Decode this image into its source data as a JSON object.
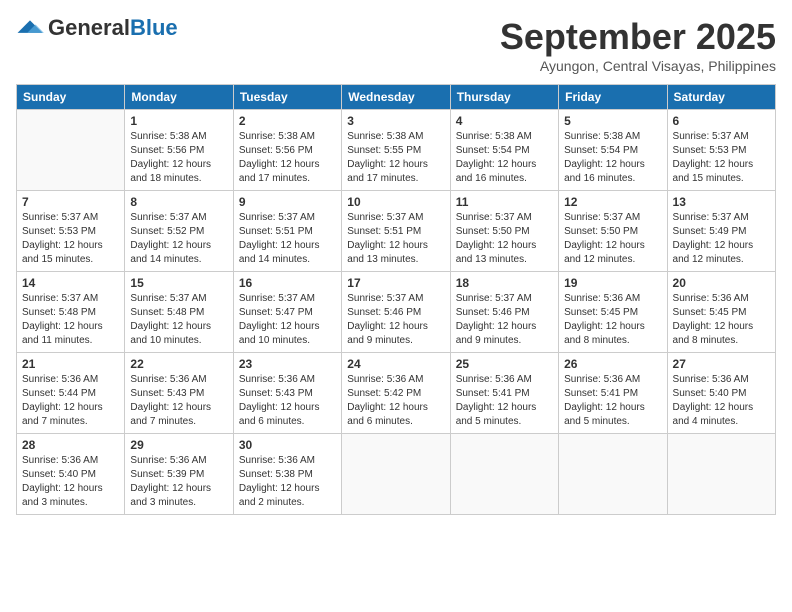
{
  "header": {
    "logo_general": "General",
    "logo_blue": "Blue",
    "month_title": "September 2025",
    "location": "Ayungon, Central Visayas, Philippines"
  },
  "weekdays": [
    "Sunday",
    "Monday",
    "Tuesday",
    "Wednesday",
    "Thursday",
    "Friday",
    "Saturday"
  ],
  "weeks": [
    [
      {
        "day": "",
        "info": ""
      },
      {
        "day": "1",
        "info": "Sunrise: 5:38 AM\nSunset: 5:56 PM\nDaylight: 12 hours\nand 18 minutes."
      },
      {
        "day": "2",
        "info": "Sunrise: 5:38 AM\nSunset: 5:56 PM\nDaylight: 12 hours\nand 17 minutes."
      },
      {
        "day": "3",
        "info": "Sunrise: 5:38 AM\nSunset: 5:55 PM\nDaylight: 12 hours\nand 17 minutes."
      },
      {
        "day": "4",
        "info": "Sunrise: 5:38 AM\nSunset: 5:54 PM\nDaylight: 12 hours\nand 16 minutes."
      },
      {
        "day": "5",
        "info": "Sunrise: 5:38 AM\nSunset: 5:54 PM\nDaylight: 12 hours\nand 16 minutes."
      },
      {
        "day": "6",
        "info": "Sunrise: 5:37 AM\nSunset: 5:53 PM\nDaylight: 12 hours\nand 15 minutes."
      }
    ],
    [
      {
        "day": "7",
        "info": "Sunrise: 5:37 AM\nSunset: 5:53 PM\nDaylight: 12 hours\nand 15 minutes."
      },
      {
        "day": "8",
        "info": "Sunrise: 5:37 AM\nSunset: 5:52 PM\nDaylight: 12 hours\nand 14 minutes."
      },
      {
        "day": "9",
        "info": "Sunrise: 5:37 AM\nSunset: 5:51 PM\nDaylight: 12 hours\nand 14 minutes."
      },
      {
        "day": "10",
        "info": "Sunrise: 5:37 AM\nSunset: 5:51 PM\nDaylight: 12 hours\nand 13 minutes."
      },
      {
        "day": "11",
        "info": "Sunrise: 5:37 AM\nSunset: 5:50 PM\nDaylight: 12 hours\nand 13 minutes."
      },
      {
        "day": "12",
        "info": "Sunrise: 5:37 AM\nSunset: 5:50 PM\nDaylight: 12 hours\nand 12 minutes."
      },
      {
        "day": "13",
        "info": "Sunrise: 5:37 AM\nSunset: 5:49 PM\nDaylight: 12 hours\nand 12 minutes."
      }
    ],
    [
      {
        "day": "14",
        "info": "Sunrise: 5:37 AM\nSunset: 5:48 PM\nDaylight: 12 hours\nand 11 minutes."
      },
      {
        "day": "15",
        "info": "Sunrise: 5:37 AM\nSunset: 5:48 PM\nDaylight: 12 hours\nand 10 minutes."
      },
      {
        "day": "16",
        "info": "Sunrise: 5:37 AM\nSunset: 5:47 PM\nDaylight: 12 hours\nand 10 minutes."
      },
      {
        "day": "17",
        "info": "Sunrise: 5:37 AM\nSunset: 5:46 PM\nDaylight: 12 hours\nand 9 minutes."
      },
      {
        "day": "18",
        "info": "Sunrise: 5:37 AM\nSunset: 5:46 PM\nDaylight: 12 hours\nand 9 minutes."
      },
      {
        "day": "19",
        "info": "Sunrise: 5:36 AM\nSunset: 5:45 PM\nDaylight: 12 hours\nand 8 minutes."
      },
      {
        "day": "20",
        "info": "Sunrise: 5:36 AM\nSunset: 5:45 PM\nDaylight: 12 hours\nand 8 minutes."
      }
    ],
    [
      {
        "day": "21",
        "info": "Sunrise: 5:36 AM\nSunset: 5:44 PM\nDaylight: 12 hours\nand 7 minutes."
      },
      {
        "day": "22",
        "info": "Sunrise: 5:36 AM\nSunset: 5:43 PM\nDaylight: 12 hours\nand 7 minutes."
      },
      {
        "day": "23",
        "info": "Sunrise: 5:36 AM\nSunset: 5:43 PM\nDaylight: 12 hours\nand 6 minutes."
      },
      {
        "day": "24",
        "info": "Sunrise: 5:36 AM\nSunset: 5:42 PM\nDaylight: 12 hours\nand 6 minutes."
      },
      {
        "day": "25",
        "info": "Sunrise: 5:36 AM\nSunset: 5:41 PM\nDaylight: 12 hours\nand 5 minutes."
      },
      {
        "day": "26",
        "info": "Sunrise: 5:36 AM\nSunset: 5:41 PM\nDaylight: 12 hours\nand 5 minutes."
      },
      {
        "day": "27",
        "info": "Sunrise: 5:36 AM\nSunset: 5:40 PM\nDaylight: 12 hours\nand 4 minutes."
      }
    ],
    [
      {
        "day": "28",
        "info": "Sunrise: 5:36 AM\nSunset: 5:40 PM\nDaylight: 12 hours\nand 3 minutes."
      },
      {
        "day": "29",
        "info": "Sunrise: 5:36 AM\nSunset: 5:39 PM\nDaylight: 12 hours\nand 3 minutes."
      },
      {
        "day": "30",
        "info": "Sunrise: 5:36 AM\nSunset: 5:38 PM\nDaylight: 12 hours\nand 2 minutes."
      },
      {
        "day": "",
        "info": ""
      },
      {
        "day": "",
        "info": ""
      },
      {
        "day": "",
        "info": ""
      },
      {
        "day": "",
        "info": ""
      }
    ]
  ]
}
